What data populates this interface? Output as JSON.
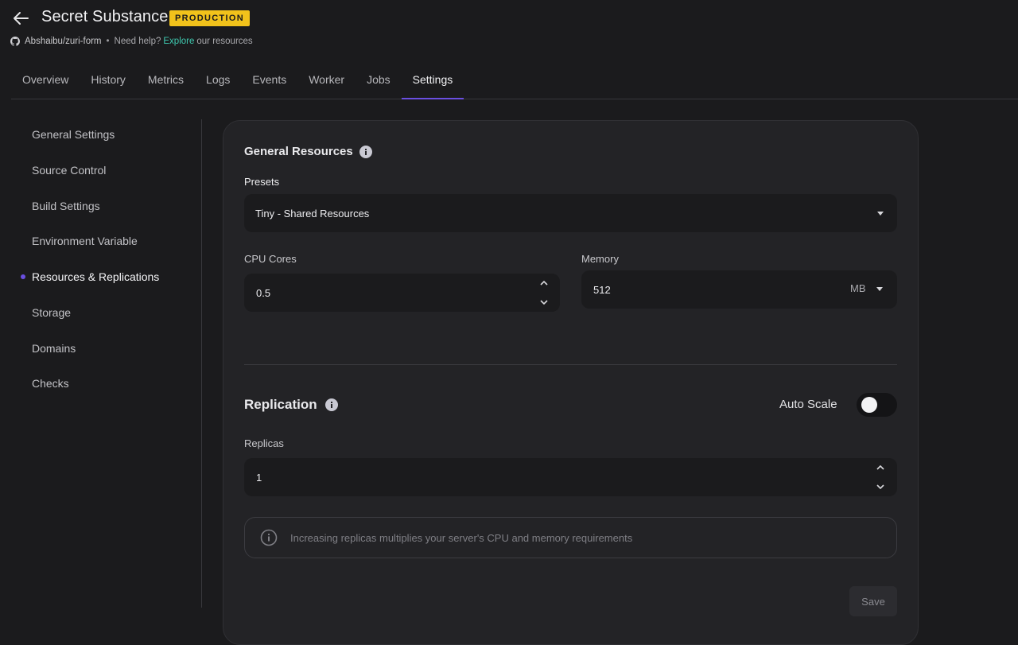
{
  "header": {
    "title": "Secret Substance",
    "environment_badge": "PRODUCTION",
    "repo": "Abshaibu/zuri-form",
    "separator": "•",
    "help_text": "Need help?",
    "help_link": "Explore",
    "help_suffix": "our resources"
  },
  "tabs": [
    {
      "label": "Overview"
    },
    {
      "label": "History"
    },
    {
      "label": "Metrics"
    },
    {
      "label": "Logs"
    },
    {
      "label": "Events"
    },
    {
      "label": "Worker"
    },
    {
      "label": "Jobs"
    },
    {
      "label": "Settings",
      "active": true
    }
  ],
  "sidebar": {
    "items": [
      {
        "label": "General Settings"
      },
      {
        "label": "Source Control"
      },
      {
        "label": "Build Settings"
      },
      {
        "label": "Environment Variable"
      },
      {
        "label": "Resources & Replications",
        "active": true
      },
      {
        "label": "Storage"
      },
      {
        "label": "Domains"
      },
      {
        "label": "Checks"
      }
    ]
  },
  "resources": {
    "title": "General Resources",
    "presets_label": "Presets",
    "presets_value": "Tiny - Shared Resources",
    "cpu_label": "CPU Cores",
    "cpu_value": "0.5",
    "memory_label": "Memory",
    "memory_value": "512",
    "memory_unit": "MB"
  },
  "replication": {
    "title": "Replication",
    "auto_scale_label": "Auto Scale",
    "auto_scale_on": false,
    "replicas_label": "Replicas",
    "replicas_value": "1",
    "notice": "Increasing replicas multiplies your server's CPU and memory requirements",
    "save_label": "Save"
  },
  "colors": {
    "background": "#1b1b1d",
    "card": "#232326",
    "accent": "#6a4fe0",
    "badge": "#f1c21b",
    "link": "#3fcab0"
  }
}
